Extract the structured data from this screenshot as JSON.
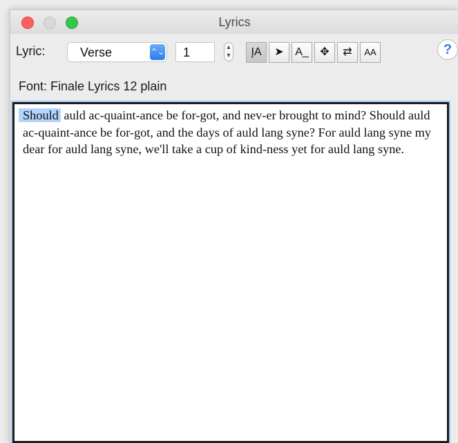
{
  "window": {
    "title": "Lyrics"
  },
  "toolbar": {
    "lyric_label": "Lyric:",
    "lyric_type": "Verse",
    "verse_number": "1",
    "tools": [
      {
        "icon": "i-beam-A-icon",
        "glyph": "ĮA"
      },
      {
        "icon": "arrow-pointer-icon",
        "glyph": "➤"
      },
      {
        "icon": "A-underline-icon",
        "glyph": "A_"
      },
      {
        "icon": "move-cross-icon",
        "glyph": "✥"
      },
      {
        "icon": "swap-arrows-icon",
        "glyph": "⇄"
      },
      {
        "icon": "A-small-caps-icon",
        "glyph": "AA"
      }
    ],
    "help_glyph": "?"
  },
  "font_info": "Font:  Finale Lyrics 12 plain",
  "editor": {
    "selected_word": "Should",
    "text_rest": " auld ac-quaint-ance be for-got, and nev-er brought to mind? Should auld ac-quaint-ance be for-got, and the days of auld lang syne? For auld lang syne my dear for auld lang syne, we'll take a cup of kind-ness yet for auld lang syne."
  },
  "colors": {
    "selection": "#b3d4fc",
    "accent": "#2a7de9"
  }
}
